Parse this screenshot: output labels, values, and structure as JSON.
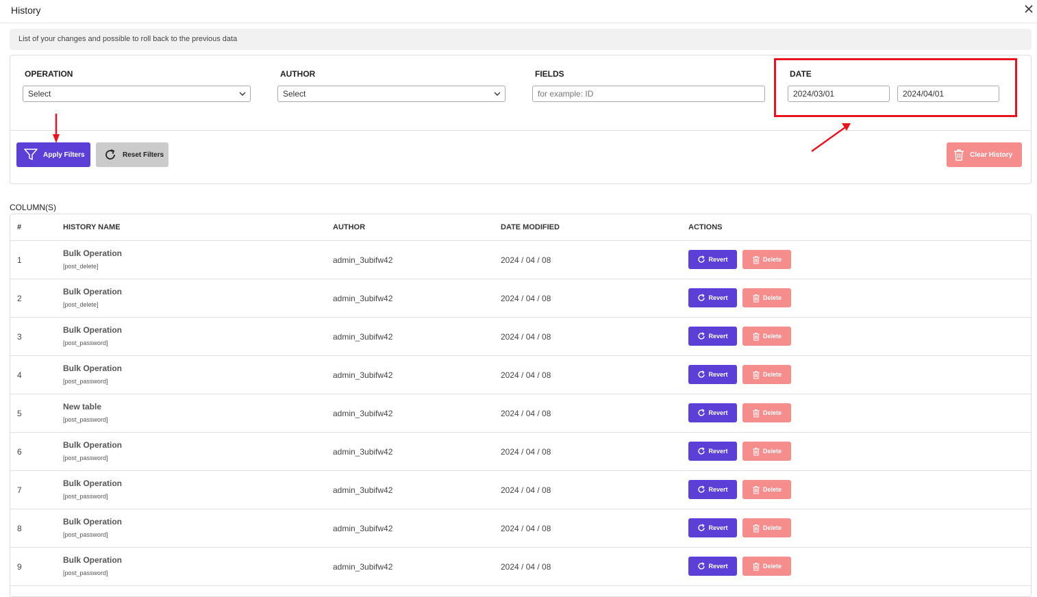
{
  "window": {
    "title": "History",
    "close_icon": "close-icon"
  },
  "description": "List of your changes and possible to roll back to the previous data",
  "filters": {
    "operation": {
      "label": "OPERATION",
      "value": "Select"
    },
    "author": {
      "label": "AUTHOR",
      "value": "Select"
    },
    "fields": {
      "label": "FIELDS",
      "placeholder": "for example: ID"
    },
    "date": {
      "label": "DATE",
      "from": "2024/03/01",
      "to": "2024/04/01"
    }
  },
  "buttons": {
    "apply": "Apply Filters",
    "reset": "Reset Filters",
    "clear": "Clear History"
  },
  "columns_label": "COLUMN(S)",
  "table": {
    "headers": {
      "num": "#",
      "name": "HISTORY NAME",
      "author": "AUTHOR",
      "date": "DATE MODIFIED",
      "actions": "ACTIONS"
    },
    "rows": [
      {
        "num": "1",
        "name": "Bulk Operation",
        "sub": "[post_delete]",
        "author": "admin_3ubifw42",
        "date": "2024 / 04 / 08"
      },
      {
        "num": "2",
        "name": "Bulk Operation",
        "sub": "[post_delete]",
        "author": "admin_3ubifw42",
        "date": "2024 / 04 / 08"
      },
      {
        "num": "3",
        "name": "Bulk Operation",
        "sub": "[post_password]",
        "author": "admin_3ubifw42",
        "date": "2024 / 04 / 08"
      },
      {
        "num": "4",
        "name": "Bulk Operation",
        "sub": "[post_password]",
        "author": "admin_3ubifw42",
        "date": "2024 / 04 / 08"
      },
      {
        "num": "5",
        "name": "New table",
        "sub": "[post_password]",
        "author": "admin_3ubifw42",
        "date": "2024 / 04 / 08"
      },
      {
        "num": "6",
        "name": "Bulk Operation",
        "sub": "[post_password]",
        "author": "admin_3ubifw42",
        "date": "2024 / 04 / 08"
      },
      {
        "num": "7",
        "name": "Bulk Operation",
        "sub": "[post_password]",
        "author": "admin_3ubifw42",
        "date": "2024 / 04 / 08"
      },
      {
        "num": "8",
        "name": "Bulk Operation",
        "sub": "[post_password]",
        "author": "admin_3ubifw42",
        "date": "2024 / 04 / 08"
      },
      {
        "num": "9",
        "name": "Bulk Operation",
        "sub": "[post_password]",
        "author": "admin_3ubifw42",
        "date": "2024 / 04 / 08"
      }
    ],
    "revert_label": "Revert",
    "delete_label": "Delete"
  },
  "colors": {
    "accent": "#5b3fd6",
    "danger": "#f58d8d",
    "annotation": "#e8131f"
  }
}
